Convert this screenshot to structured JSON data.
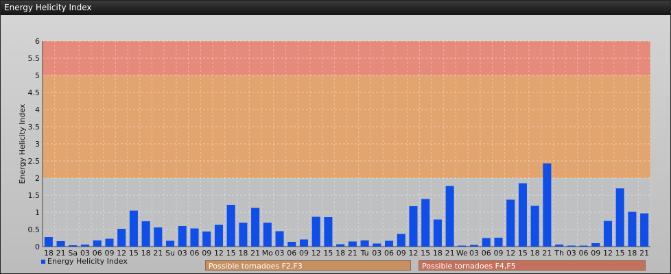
{
  "window": {
    "title": "Energy Helicity Index"
  },
  "legend": {
    "series_label": "Energy Helicity Index",
    "series_color": "#0f4ee8"
  },
  "bands": [
    {
      "label": "Possible tornadoes F2,F3",
      "color": "#c69060"
    },
    {
      "label": "Possible tornadoes F4,F5",
      "color": "#c4705c"
    }
  ],
  "chart_data": {
    "type": "bar",
    "ylabel": "Energy Helicity Index",
    "xlabel": "",
    "ylim": [
      0,
      6
    ],
    "yticks": [
      "0",
      "0.5",
      "1",
      "1.5",
      "2",
      "2.5",
      "3",
      "3.5",
      "4",
      "4.5",
      "5",
      "5.5",
      "6"
    ],
    "grid": true,
    "legend_position": "bottom-left",
    "zones": [
      {
        "from": 2,
        "to": 5,
        "color": "#e8a060"
      },
      {
        "from": 5,
        "to": 6,
        "color": "#ec8070"
      }
    ],
    "categories": [
      "18",
      "21",
      "Sa",
      "03",
      "06",
      "09",
      "12",
      "15",
      "18",
      "21",
      "Su",
      "03",
      "06",
      "09",
      "12",
      "15",
      "18",
      "21",
      "Mo",
      "03",
      "06",
      "09",
      "12",
      "15",
      "18",
      "21",
      "Tu",
      "03",
      "06",
      "09",
      "12",
      "15",
      "18",
      "21",
      "We",
      "03",
      "06",
      "09",
      "12",
      "15",
      "18",
      "21",
      "Th",
      "03",
      "06",
      "09",
      "12",
      "15",
      "18",
      "21"
    ],
    "series": [
      {
        "name": "Energy Helicity Index",
        "values": [
          0.28,
          0.16,
          0.04,
          0.06,
          0.18,
          0.23,
          0.52,
          1.05,
          0.74,
          0.56,
          0.17,
          0.6,
          0.53,
          0.44,
          0.64,
          1.22,
          0.7,
          1.13,
          0.7,
          0.45,
          0.14,
          0.21,
          0.87,
          0.86,
          0.07,
          0.15,
          0.18,
          0.09,
          0.17,
          0.37,
          1.18,
          1.39,
          0.79,
          1.77,
          0.03,
          0.05,
          0.25,
          0.26,
          1.37,
          1.85,
          1.19,
          2.43,
          0.06,
          0.03,
          0.03,
          0.1,
          0.75,
          1.7,
          1.02,
          0.97
        ]
      }
    ]
  }
}
